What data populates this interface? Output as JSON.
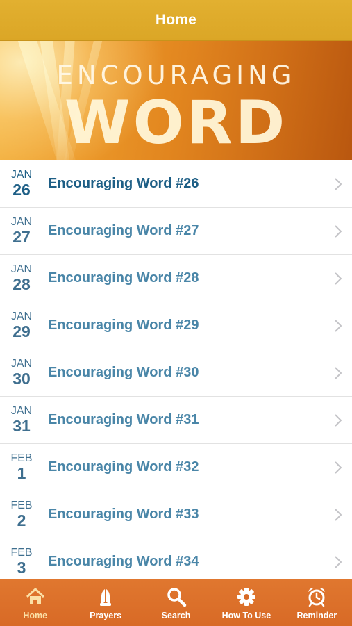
{
  "navbar": {
    "title": "Home"
  },
  "banner": {
    "line1": "ENCOURAGING",
    "line2": "WORD"
  },
  "items": [
    {
      "month": "JAN",
      "day": "26",
      "title": "Encouraging Word #26"
    },
    {
      "month": "JAN",
      "day": "27",
      "title": "Encouraging Word #27"
    },
    {
      "month": "JAN",
      "day": "28",
      "title": "Encouraging Word #28"
    },
    {
      "month": "JAN",
      "day": "29",
      "title": "Encouraging Word #29"
    },
    {
      "month": "JAN",
      "day": "30",
      "title": "Encouraging Word #30"
    },
    {
      "month": "JAN",
      "day": "31",
      "title": "Encouraging Word #31"
    },
    {
      "month": "FEB",
      "day": "1",
      "title": "Encouraging Word #32"
    },
    {
      "month": "FEB",
      "day": "2",
      "title": "Encouraging Word #33"
    },
    {
      "month": "FEB",
      "day": "3",
      "title": "Encouraging Word #34"
    }
  ],
  "tabs": [
    {
      "label": "Home",
      "icon": "home-icon",
      "active": true
    },
    {
      "label": "Prayers",
      "icon": "praying-hands-icon"
    },
    {
      "label": "Search",
      "icon": "search-icon"
    },
    {
      "label": "How To Use",
      "icon": "gear-icon"
    },
    {
      "label": "Reminder",
      "icon": "alarm-clock-icon"
    }
  ],
  "colors": {
    "navbar": "#dba626",
    "tabbar": "#d86a26",
    "title_text": "#4a86a8",
    "active_title_text": "#1e5f86",
    "active_tab_label": "#fbe0a6"
  }
}
